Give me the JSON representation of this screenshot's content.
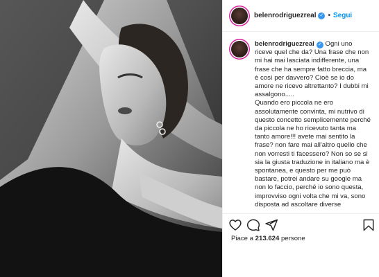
{
  "post": {
    "username": "belenrodriguezreal",
    "verified_symbol": "✓",
    "separator": "•",
    "follow_label": "Segui",
    "caption_username": "belenrodriguezreal",
    "caption": " Ogni uno riceve quel che da? Una frase che non mi hai mai lasciata indifferente, una frase che ha sempre fatto breccia, ma è così per davvero? Cioè se io do amore ne ricevo altrettanto? I dubbi mi assalgono.....\nQuando ero piccola ne ero assolutamente convinta, mi nutrivo di questo concetto semplicemente perché da piccola ne ho ricevuto tanta ma tanto amore!!! avete mai sentito la frase? non fare mai all'altro quello che non vorresti ti facessero? Non so se si sia la giusta traduzione in italiano ma è spontanea, e questo per me può bastare, potrei andare su google ma non lo faccio, perché io sono questa, improvviso ogni volta che mi va, sono disposta ad ascoltare diverse",
    "likes_prefix": "Piace a ",
    "likes_count": "213.624",
    "likes_suffix": " persone"
  },
  "icons": {
    "like": "heart-icon",
    "comment": "comment-icon",
    "share": "share-icon",
    "save": "bookmark-icon"
  },
  "colors": {
    "accent": "#0095f6",
    "verified": "#3897f0",
    "border": "#efefef",
    "text": "#262626"
  }
}
